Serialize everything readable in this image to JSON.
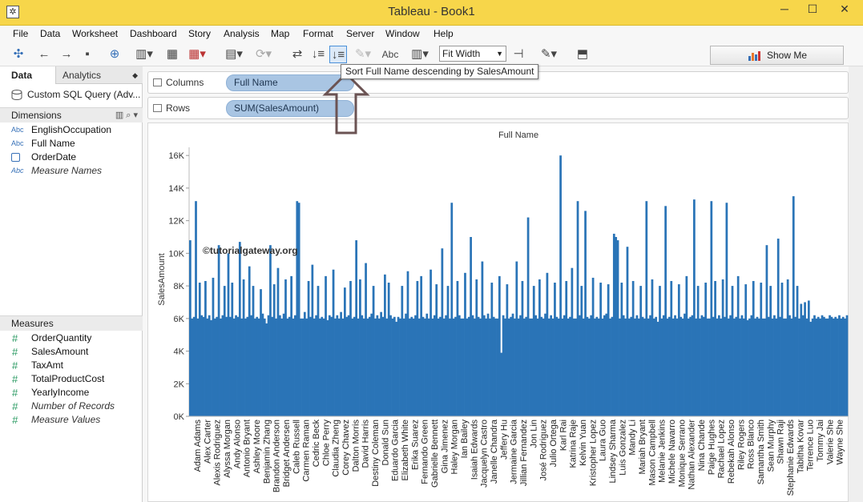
{
  "window": {
    "title": "Tableau - Book1",
    "minimize": "─",
    "maximize": "☐",
    "close": "✕"
  },
  "menu": [
    "File",
    "Data",
    "Worksheet",
    "Dashboard",
    "Story",
    "Analysis",
    "Map",
    "Format",
    "Server",
    "Window",
    "Help"
  ],
  "toolbar": {
    "fit_label": "Fit Width",
    "abc_label": "Abc",
    "show_me_label": "Show Me",
    "tooltip": "Sort Full Name descending by SalesAmount"
  },
  "left_panel": {
    "tabs": {
      "data": "Data",
      "analytics": "Analytics"
    },
    "data_source": "Custom SQL Query (Adv...",
    "dimensions_header": "Dimensions",
    "dimensions": [
      {
        "type": "Abc",
        "name": "EnglishOccupation"
      },
      {
        "type": "Abc",
        "name": "Full Name"
      },
      {
        "type": "date",
        "name": "OrderDate"
      },
      {
        "type": "Abc",
        "name": "Measure Names"
      }
    ],
    "measures_header": "Measures",
    "measures": [
      {
        "type": "#",
        "name": "OrderQuantity"
      },
      {
        "type": "#",
        "name": "SalesAmount"
      },
      {
        "type": "#",
        "name": "TaxAmt"
      },
      {
        "type": "#",
        "name": "TotalProductCost"
      },
      {
        "type": "#",
        "name": "YearlyIncome"
      },
      {
        "type": "#",
        "name": "Number of Records"
      },
      {
        "type": "#",
        "name": "Measure Values"
      }
    ]
  },
  "shelves": {
    "columns_label": "Columns",
    "columns_pill": "Full Name",
    "rows_label": "Rows",
    "rows_pill": "SUM(SalesAmount)"
  },
  "chart_data": {
    "type": "bar",
    "title": "Full Name",
    "xlabel": "",
    "ylabel": "SalesAmount",
    "ylim": [
      0,
      16500
    ],
    "yticks": [
      0,
      2000,
      4000,
      6000,
      8000,
      10000,
      12000,
      14000,
      16000
    ],
    "ytick_labels": [
      "0K",
      "2K",
      "4K",
      "6K",
      "8K",
      "10K",
      "12K",
      "14K",
      "16K"
    ],
    "color": "#2a74b7",
    "watermark": "©tutorialgateway.org",
    "categories": [
      "Adam Adams",
      "Alex Carter",
      "Alexis Rodriguez",
      "Alyssa Morgan",
      "Andy Alonso",
      "Antonio Bryant",
      "Ashley Moore",
      "Benjamin Zhang",
      "Brandon Anderson",
      "Bridget Andersen",
      "Caleb Russell",
      "Carmen Raman",
      "Cedric Beck",
      "Chloe Perry",
      "Claudia Zheng",
      "Corey Chavez",
      "Dalton Morris",
      "David Harris",
      "Destiny Coleman",
      "Donald Sun",
      "Eduardo Garcia",
      "Elizabeth White",
      "Erika Suarez",
      "Fernando Green",
      "Gabrielle Bennett",
      "Gina Jimenez",
      "Haley Morgan",
      "Ian Bailey",
      "Isaiah Edwards",
      "Jacquelyn Castro",
      "Janelle Chandra",
      "Jeffery Hu",
      "Jermaine Garcia",
      "Jillian Fernandez",
      "Jon Lin",
      "José Rodriguez",
      "Julio Ortega",
      "Karl Rai",
      "Katrina Raje",
      "Kelvin Yuan",
      "Kristopher Lopez",
      "Laura Guo",
      "Lindsey Sharma",
      "Luis Gonzalez",
      "Mandy Li",
      "Mariah Bryant",
      "Mason Campbell",
      "Melanie Jenkins",
      "Michele Navarro",
      "Monique Serrano",
      "Nathan Alexander",
      "Nina Chande",
      "Paige Hughes",
      "Rachael Lopez",
      "Rebekah Alonso",
      "Riley Rogers",
      "Ross Blanco",
      "Samantha Smith",
      "Sean Murphy",
      "Shawn Raji",
      "Stephanie Edwards",
      "Tabitha Kovar",
      "Terrence Luo",
      "Tommy Jai",
      "Valerie She",
      "Wayne She"
    ],
    "bar_count": 330,
    "series": [
      {
        "values": [
          10800,
          6000,
          6100,
          13200,
          6000,
          8200,
          6200,
          6100,
          8300,
          6000,
          6200,
          5900,
          8500,
          6000,
          6100,
          10500,
          6000,
          6200,
          8000,
          6100,
          10000,
          6100,
          8200,
          6000,
          6200,
          6100,
          10700,
          6000,
          8400,
          6000,
          6100,
          9200,
          6200,
          8000,
          6000,
          6100,
          6000,
          7800,
          6300,
          6000,
          5700,
          6200,
          10500,
          6100,
          8100,
          6000,
          9100,
          6200,
          6000,
          6300,
          8400,
          6000,
          6100,
          8600,
          6000,
          6200,
          13200,
          13100,
          6000,
          6000,
          6400,
          6000,
          8300,
          6100,
          9300,
          6000,
          6200,
          8000,
          6000,
          6100,
          6000,
          8600,
          5900,
          6200,
          6100,
          9000,
          6000,
          6200,
          6000,
          6400,
          6000,
          7900,
          6100,
          6200,
          8300,
          6000,
          6100,
          10800,
          6000,
          8400,
          6200,
          6000,
          9400,
          6000,
          6100,
          6300,
          8000,
          6000,
          6200,
          6000,
          6400,
          6100,
          8700,
          6000,
          8200,
          6200,
          6000,
          6100,
          5800,
          6100,
          6000,
          8000,
          6000,
          6300,
          8900,
          6000,
          6100,
          6000,
          6200,
          8300,
          6000,
          8600,
          6100,
          6000,
          6300,
          6000,
          9000,
          6000,
          6200,
          8100,
          6000,
          6100,
          10300,
          6000,
          6200,
          8000,
          6000,
          13100,
          6000,
          6100,
          8300,
          6200,
          6000,
          6000,
          8800,
          6000,
          6100,
          11000,
          6200,
          6000,
          8400,
          6100,
          6000,
          9500,
          6200,
          6000,
          6300,
          6000,
          8200,
          6100,
          6000,
          6000,
          8600,
          3900,
          6200,
          6000,
          8100,
          6000,
          6100,
          6300,
          6000,
          9500,
          6000,
          6200,
          8300,
          6000,
          6100,
          12200,
          6000,
          6000,
          8000,
          6200,
          6000,
          8400,
          6100,
          6000,
          6300,
          8800,
          6000,
          6200,
          6000,
          8200,
          6100,
          6000,
          16000,
          6000,
          6200,
          8300,
          6000,
          6100,
          9100,
          6000,
          6000,
          13200,
          6200,
          8000,
          6000,
          12600,
          6100,
          6000,
          6200,
          8500,
          6000,
          6100,
          6000,
          8200,
          6000,
          6200,
          6300,
          8100,
          6000,
          6100,
          11200,
          11000,
          10800,
          6000,
          8200,
          6200,
          6000,
          10400,
          6000,
          6100,
          8300,
          6000,
          6200,
          6000,
          8000,
          6100,
          6000,
          13200,
          6000,
          6200,
          8400,
          6000,
          6100,
          5800,
          8000,
          6000,
          6200,
          12900,
          6000,
          6100,
          8300,
          6000,
          6200,
          6000,
          8100,
          6100,
          6000,
          6300,
          8600,
          6000,
          6100,
          6200,
          13300,
          6000,
          8000,
          6000,
          6200,
          6100,
          8200,
          6000,
          6000,
          13200,
          6100,
          8300,
          6000,
          6200,
          6000,
          8400,
          6100,
          13100,
          6000,
          6200,
          8000,
          6000,
          6100,
          8600,
          6000,
          6200,
          6000,
          8100,
          5900,
          6000,
          6200,
          8300,
          6000,
          6100,
          6000,
          8200,
          6000,
          6000,
          10500,
          6100,
          8000,
          6000,
          6200,
          6000,
          10900,
          6100,
          8200,
          6000,
          6000,
          8400,
          6200,
          6000,
          13500,
          6100,
          8000,
          6000,
          6900,
          6200,
          7000,
          6000,
          7100,
          5800,
          6000,
          6200,
          6000,
          6100,
          6000,
          6200,
          6100,
          6000,
          6000,
          6200,
          6100,
          6000,
          6100,
          6000,
          6200,
          6000,
          6100,
          6000,
          6200
        ]
      }
    ]
  }
}
